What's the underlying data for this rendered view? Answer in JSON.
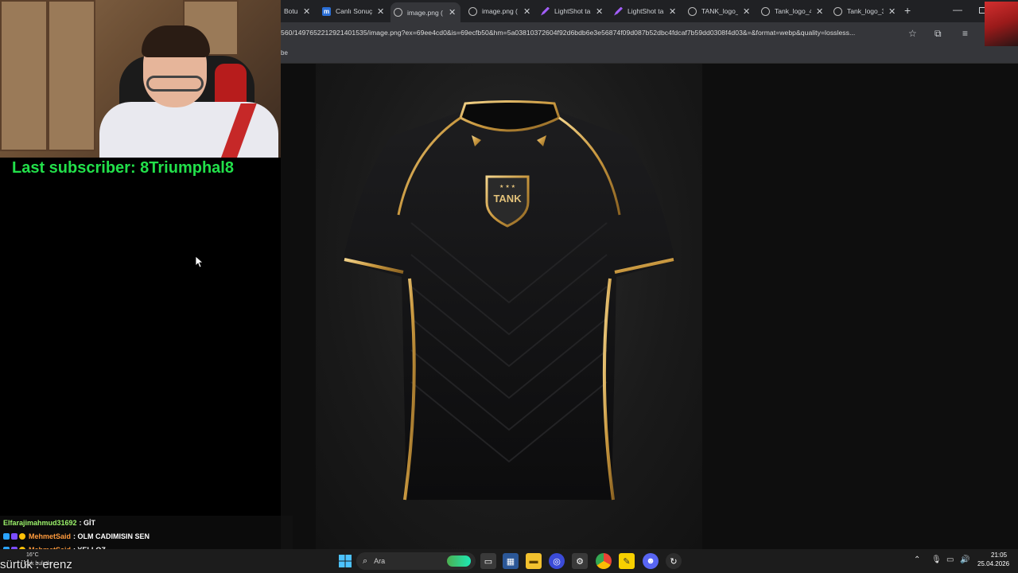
{
  "stream": {
    "last_subscriber": "Last subscriber: 8Triumphal8"
  },
  "browser": {
    "tabs": [
      {
        "label": "Botu",
        "icon": "blank-icon"
      },
      {
        "label": "Canlı Sonuç",
        "icon": "m-icon"
      },
      {
        "label": "image.png (",
        "icon": "globe-icon",
        "active": true
      },
      {
        "label": "image.png (",
        "icon": "globe-icon"
      },
      {
        "label": "LightShot ta",
        "icon": "pen-icon"
      },
      {
        "label": "LightShot ta",
        "icon": "pen-icon"
      },
      {
        "label": "TANK_logo_",
        "icon": "globe-icon"
      },
      {
        "label": "Tank_logo_4",
        "icon": "globe-icon"
      },
      {
        "label": "Tank_logo_3",
        "icon": "globe-icon"
      }
    ],
    "url": "560/1497652212921401535/image.png?ex=69ee4cd0&is=69ecfb50&hm=5a03810372604f92d6bdb6e3e56874f09d087b52dbc4fdcaf7b59dd0308f4d03&=&format=webp&quality=lossless...",
    "bookmark_text": "be",
    "image": {
      "logo_text": "TANK"
    }
  },
  "chat": [
    {
      "user": "Elfarajimahmud31692",
      "message": ": GİT",
      "color": "#9cf36b",
      "badges": []
    },
    {
      "user": "MehmetSaid",
      "message": ": OLM CADIMISIN SEN",
      "color": "#ff9b3d",
      "badges": [
        "#2aa3ff",
        "#7c4dff",
        "#ffc107"
      ]
    },
    {
      "user": "MehmetSaid",
      "message": ": YELLOZ",
      "color": "#ff9b3d",
      "badges": [
        "#2aa3ff",
        "#7c4dff",
        "#ffc107"
      ]
    }
  ],
  "overlay_bottom": "sürtük : erenz",
  "weather": {
    "temp": "16°C",
    "desc": "Çok bulutlu"
  },
  "taskbar": {
    "search_placeholder": "Ara",
    "time": "21:05",
    "date": "25.04.2026"
  }
}
